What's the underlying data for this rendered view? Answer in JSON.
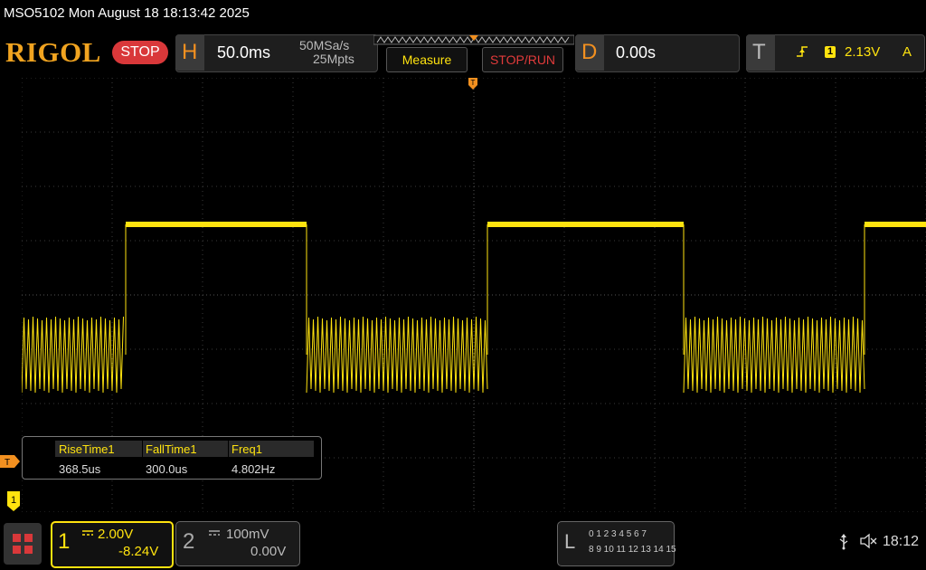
{
  "status": {
    "model_datetime": "MSO5102  Mon August 18 18:13:42 2025"
  },
  "header": {
    "logo": "RIGOL",
    "run_state": "STOP",
    "horizontal": {
      "letter": "H",
      "timebase": "50.0ms",
      "sample_rate": "50MSa/s",
      "memory_depth": "25Mpts"
    },
    "measure_button": "Measure",
    "stoprun_button": "STOP/RUN",
    "delay": {
      "letter": "D",
      "value": "0.00s"
    },
    "trigger": {
      "letter": "T",
      "edge_icon": "rising-edge-icon",
      "source": "1",
      "level": "2.13V",
      "mode": "A"
    }
  },
  "markers": {
    "trigger_level": "T",
    "ch1_ground": "1"
  },
  "measurements": {
    "headers": [
      "RiseTime1",
      "FallTime1",
      "Freq1"
    ],
    "values": [
      "368.5us",
      "300.0us",
      "4.802Hz"
    ]
  },
  "channels": {
    "ch1": {
      "number": "1",
      "scale": "2.00V",
      "offset": "-8.24V",
      "color": "#ffe30f"
    },
    "ch2": {
      "number": "2",
      "scale": "100mV",
      "offset": "0.00V",
      "color": "#bbbbbb"
    }
  },
  "logic": {
    "letter": "L",
    "row1": "0 1 2 3  4 5 6 7",
    "row2": "8  9 10 11  12 13 14 15"
  },
  "systray": {
    "usb_icon": "usb-icon",
    "speaker_icon": "speaker-muted-icon",
    "time": "18:12"
  },
  "colors": {
    "accent_orange": "#f29020",
    "ch1_yellow": "#ffe30f",
    "stop_red": "#d9383a"
  },
  "waveform": {
    "segments": [
      {
        "state": "low",
        "t_start": -5.0,
        "t_end": -3.85
      },
      {
        "state": "high",
        "t_start": -3.85,
        "t_end": -1.85
      },
      {
        "state": "low",
        "t_start": -1.85,
        "t_end": 0.15
      },
      {
        "state": "high",
        "t_start": 0.15,
        "t_end": 2.32
      },
      {
        "state": "low",
        "t_start": 2.32,
        "t_end": 4.32
      },
      {
        "state": "high",
        "t_start": 4.32,
        "t_end": 5.0
      }
    ],
    "high_level_div": 1.3,
    "low_center_div": -1.1,
    "low_ripple_div": 0.7
  }
}
